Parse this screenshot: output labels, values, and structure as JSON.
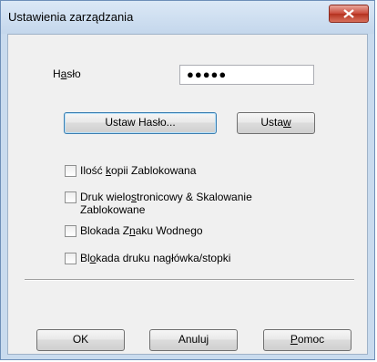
{
  "window": {
    "title": "Ustawienia zarządzania"
  },
  "password": {
    "label_before": "H",
    "label_accel": "a",
    "label_after": "sło",
    "value": "●●●●●"
  },
  "buttons": {
    "set_password": {
      "before": "Ustaw Hasło...",
      "accel": "",
      "after": ""
    },
    "set": {
      "before": "Usta",
      "accel": "w",
      "after": ""
    },
    "ok": {
      "before": "OK",
      "accel": "",
      "after": ""
    },
    "cancel": {
      "before": "Anuluj",
      "accel": "",
      "after": ""
    },
    "help": {
      "before": "",
      "accel": "P",
      "after": "omoc"
    }
  },
  "options": [
    {
      "before": "Ilość ",
      "accel": "k",
      "after": "opii Zablokowana",
      "line2": "",
      "checked": false
    },
    {
      "before": "Druk wielo",
      "accel": "s",
      "after": "tronicowy & Skalowanie",
      "line2": "Zablokowane",
      "checked": false
    },
    {
      "before": "Blokada Z",
      "accel": "n",
      "after": "aku Wodnego",
      "line2": "",
      "checked": false
    },
    {
      "before": "Bl",
      "accel": "o",
      "after": "kada druku nagłówka/stopki",
      "line2": "",
      "checked": false
    }
  ]
}
